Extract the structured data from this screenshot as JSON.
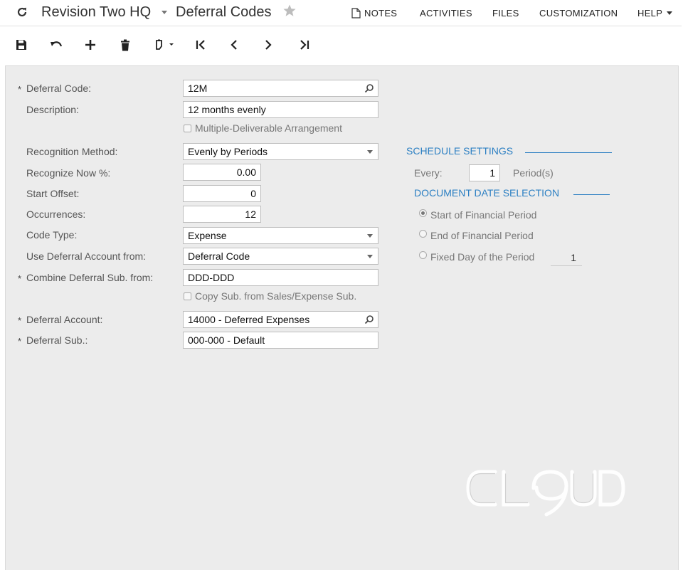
{
  "header": {
    "company": "Revision Two HQ",
    "page_title": "Deferral Codes",
    "nav": [
      "NOTES",
      "ACTIVITIES",
      "FILES",
      "CUSTOMIZATION",
      "HELP"
    ]
  },
  "toolbar": {
    "icons": [
      "save-icon",
      "undo-icon",
      "add-icon",
      "delete-icon",
      "copy-paste-icon",
      "first-record-icon",
      "previous-record-icon",
      "next-record-icon",
      "last-record-icon"
    ]
  },
  "form": {
    "deferral_code_label": "Deferral Code:",
    "deferral_code": "12M",
    "description_label": "Description:",
    "description": "12 months evenly",
    "multi_deliverable_label": "Multiple-Deliverable Arrangement",
    "recognition_method_label": "Recognition Method:",
    "recognition_method": "Evenly by Periods",
    "recognize_now_label": "Recognize Now %:",
    "recognize_now": "0.00",
    "start_offset_label": "Start Offset:",
    "start_offset": "0",
    "occurrences_label": "Occurrences:",
    "occurrences": "12",
    "code_type_label": "Code Type:",
    "code_type": "Expense",
    "use_deferral_account_label": "Use Deferral Account from:",
    "use_deferral_account": "Deferral Code",
    "combine_sub_label": "Combine Deferral Sub. from:",
    "combine_sub": "DDD-DDD",
    "copy_sub_label": "Copy Sub. from Sales/Expense Sub.",
    "deferral_account_label": "Deferral Account:",
    "deferral_account": "14000 - Deferred Expenses",
    "deferral_sub_label": "Deferral Sub.:",
    "deferral_sub": "000-000 - Default",
    "required_marker": "*"
  },
  "schedule": {
    "title": "SCHEDULE SETTINGS",
    "every_label": "Every:",
    "every_value": "1",
    "periods_label": "Period(s)"
  },
  "doc_date": {
    "title": "DOCUMENT DATE SELECTION",
    "options": [
      "Start of Financial Period",
      "End of Financial Period",
      "Fixed Day of the Period"
    ],
    "selected": "Start of Financial Period",
    "fixed_day": "1"
  },
  "watermark": "CLOUD"
}
